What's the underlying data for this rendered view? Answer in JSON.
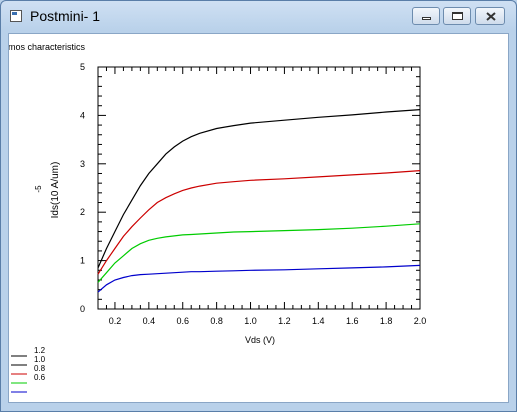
{
  "window": {
    "title": "Postmini- 1"
  },
  "chart_data": {
    "type": "line",
    "title": "nmos characteristics",
    "xlabel": "Vds (V)",
    "ylabel": "Ids(10  A/um)",
    "ylabel_exponent": "-5",
    "xlim": [
      0.1,
      2.0
    ],
    "ylim": [
      0,
      5
    ],
    "xticks": [
      0.2,
      0.4,
      0.6,
      0.8,
      1.0,
      1.2,
      1.4,
      1.6,
      1.8,
      2.0
    ],
    "xtick_labels": [
      "0.2",
      "0.4",
      "0.6",
      "0.8",
      "1.0",
      "1.2",
      "1.4",
      "1.6",
      "1.8",
      "2.0"
    ],
    "yticks": [
      0,
      1,
      2,
      3,
      4,
      5
    ],
    "ytick_labels": [
      "0",
      "1",
      "2",
      "3",
      "4",
      "5"
    ],
    "grid": false,
    "legend_position": "bottom-left",
    "legend_entries": [
      {
        "label": "1.2",
        "color": "#000000"
      },
      {
        "label": "1.0",
        "color": "#000000"
      },
      {
        "label": "0.8",
        "color": "#cc0000"
      },
      {
        "label": "0.6",
        "color": "#00cc00"
      },
      {
        "label": "",
        "color": "#0000cc"
      }
    ],
    "x": [
      0.1,
      0.15,
      0.2,
      0.25,
      0.3,
      0.35,
      0.4,
      0.45,
      0.5,
      0.55,
      0.6,
      0.65,
      0.7,
      0.8,
      0.9,
      1.0,
      1.2,
      1.4,
      1.6,
      1.8,
      2.0
    ],
    "series": [
      {
        "color": "#000000",
        "values": [
          0.85,
          1.25,
          1.6,
          1.95,
          2.25,
          2.55,
          2.8,
          3.0,
          3.2,
          3.35,
          3.47,
          3.56,
          3.63,
          3.73,
          3.79,
          3.84,
          3.9,
          3.96,
          4.01,
          4.07,
          4.12
        ]
      },
      {
        "color": "#cc0000",
        "values": [
          0.72,
          1.0,
          1.25,
          1.5,
          1.7,
          1.88,
          2.05,
          2.2,
          2.3,
          2.38,
          2.45,
          2.5,
          2.54,
          2.6,
          2.63,
          2.66,
          2.69,
          2.73,
          2.77,
          2.81,
          2.86
        ]
      },
      {
        "color": "#00cc00",
        "values": [
          0.55,
          0.75,
          0.95,
          1.1,
          1.25,
          1.35,
          1.42,
          1.46,
          1.49,
          1.51,
          1.53,
          1.54,
          1.55,
          1.57,
          1.59,
          1.6,
          1.62,
          1.64,
          1.67,
          1.71,
          1.76
        ]
      },
      {
        "color": "#0000cc",
        "values": [
          0.35,
          0.5,
          0.6,
          0.65,
          0.69,
          0.71,
          0.72,
          0.73,
          0.74,
          0.75,
          0.76,
          0.77,
          0.77,
          0.78,
          0.79,
          0.8,
          0.81,
          0.83,
          0.85,
          0.87,
          0.9
        ]
      }
    ]
  }
}
